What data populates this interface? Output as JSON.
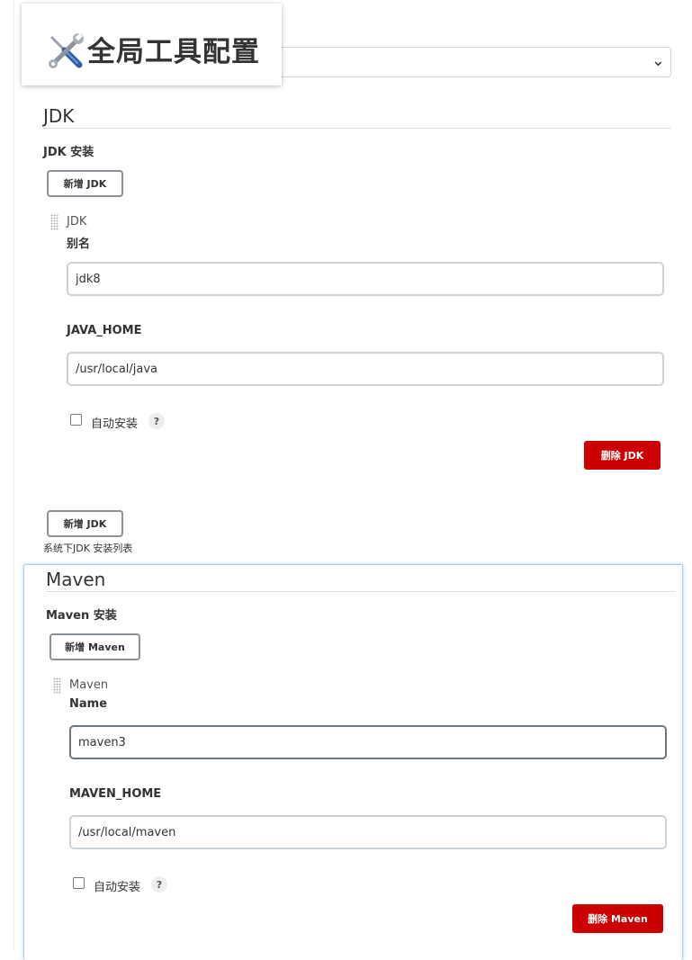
{
  "header": {
    "title": "全局工具配置",
    "icon": "tools-icon"
  },
  "jdk_section": {
    "title": "JDK",
    "subtitle": "JDK 安装",
    "add_button_top": "新增 JDK",
    "installation": {
      "label": "JDK",
      "alias_label": "别名",
      "alias_value": "jdk8",
      "java_home_label": "JAVA_HOME",
      "java_home_value": "/usr/local/java",
      "auto_install_label": "自动安装",
      "auto_install_checked": false,
      "help": "?",
      "delete_button": "删除 JDK"
    },
    "add_button_bottom": "新增 JDK",
    "helper_text": "系统下JDK 安装列表"
  },
  "maven_section": {
    "title": "Maven",
    "subtitle": "Maven 安装",
    "add_button": "新增 Maven",
    "installation": {
      "label": "Maven",
      "name_label": "Name",
      "name_value": "maven3",
      "maven_home_label": "MAVEN_HOME",
      "maven_home_value": "/usr/local/maven",
      "auto_install_label": "自动安装",
      "auto_install_checked": false,
      "help": "?",
      "delete_button": "删除 Maven"
    }
  },
  "colors": {
    "danger": "#cc0000",
    "panel_highlight": "#aacdf4",
    "input_border": "#ccd3d9"
  }
}
